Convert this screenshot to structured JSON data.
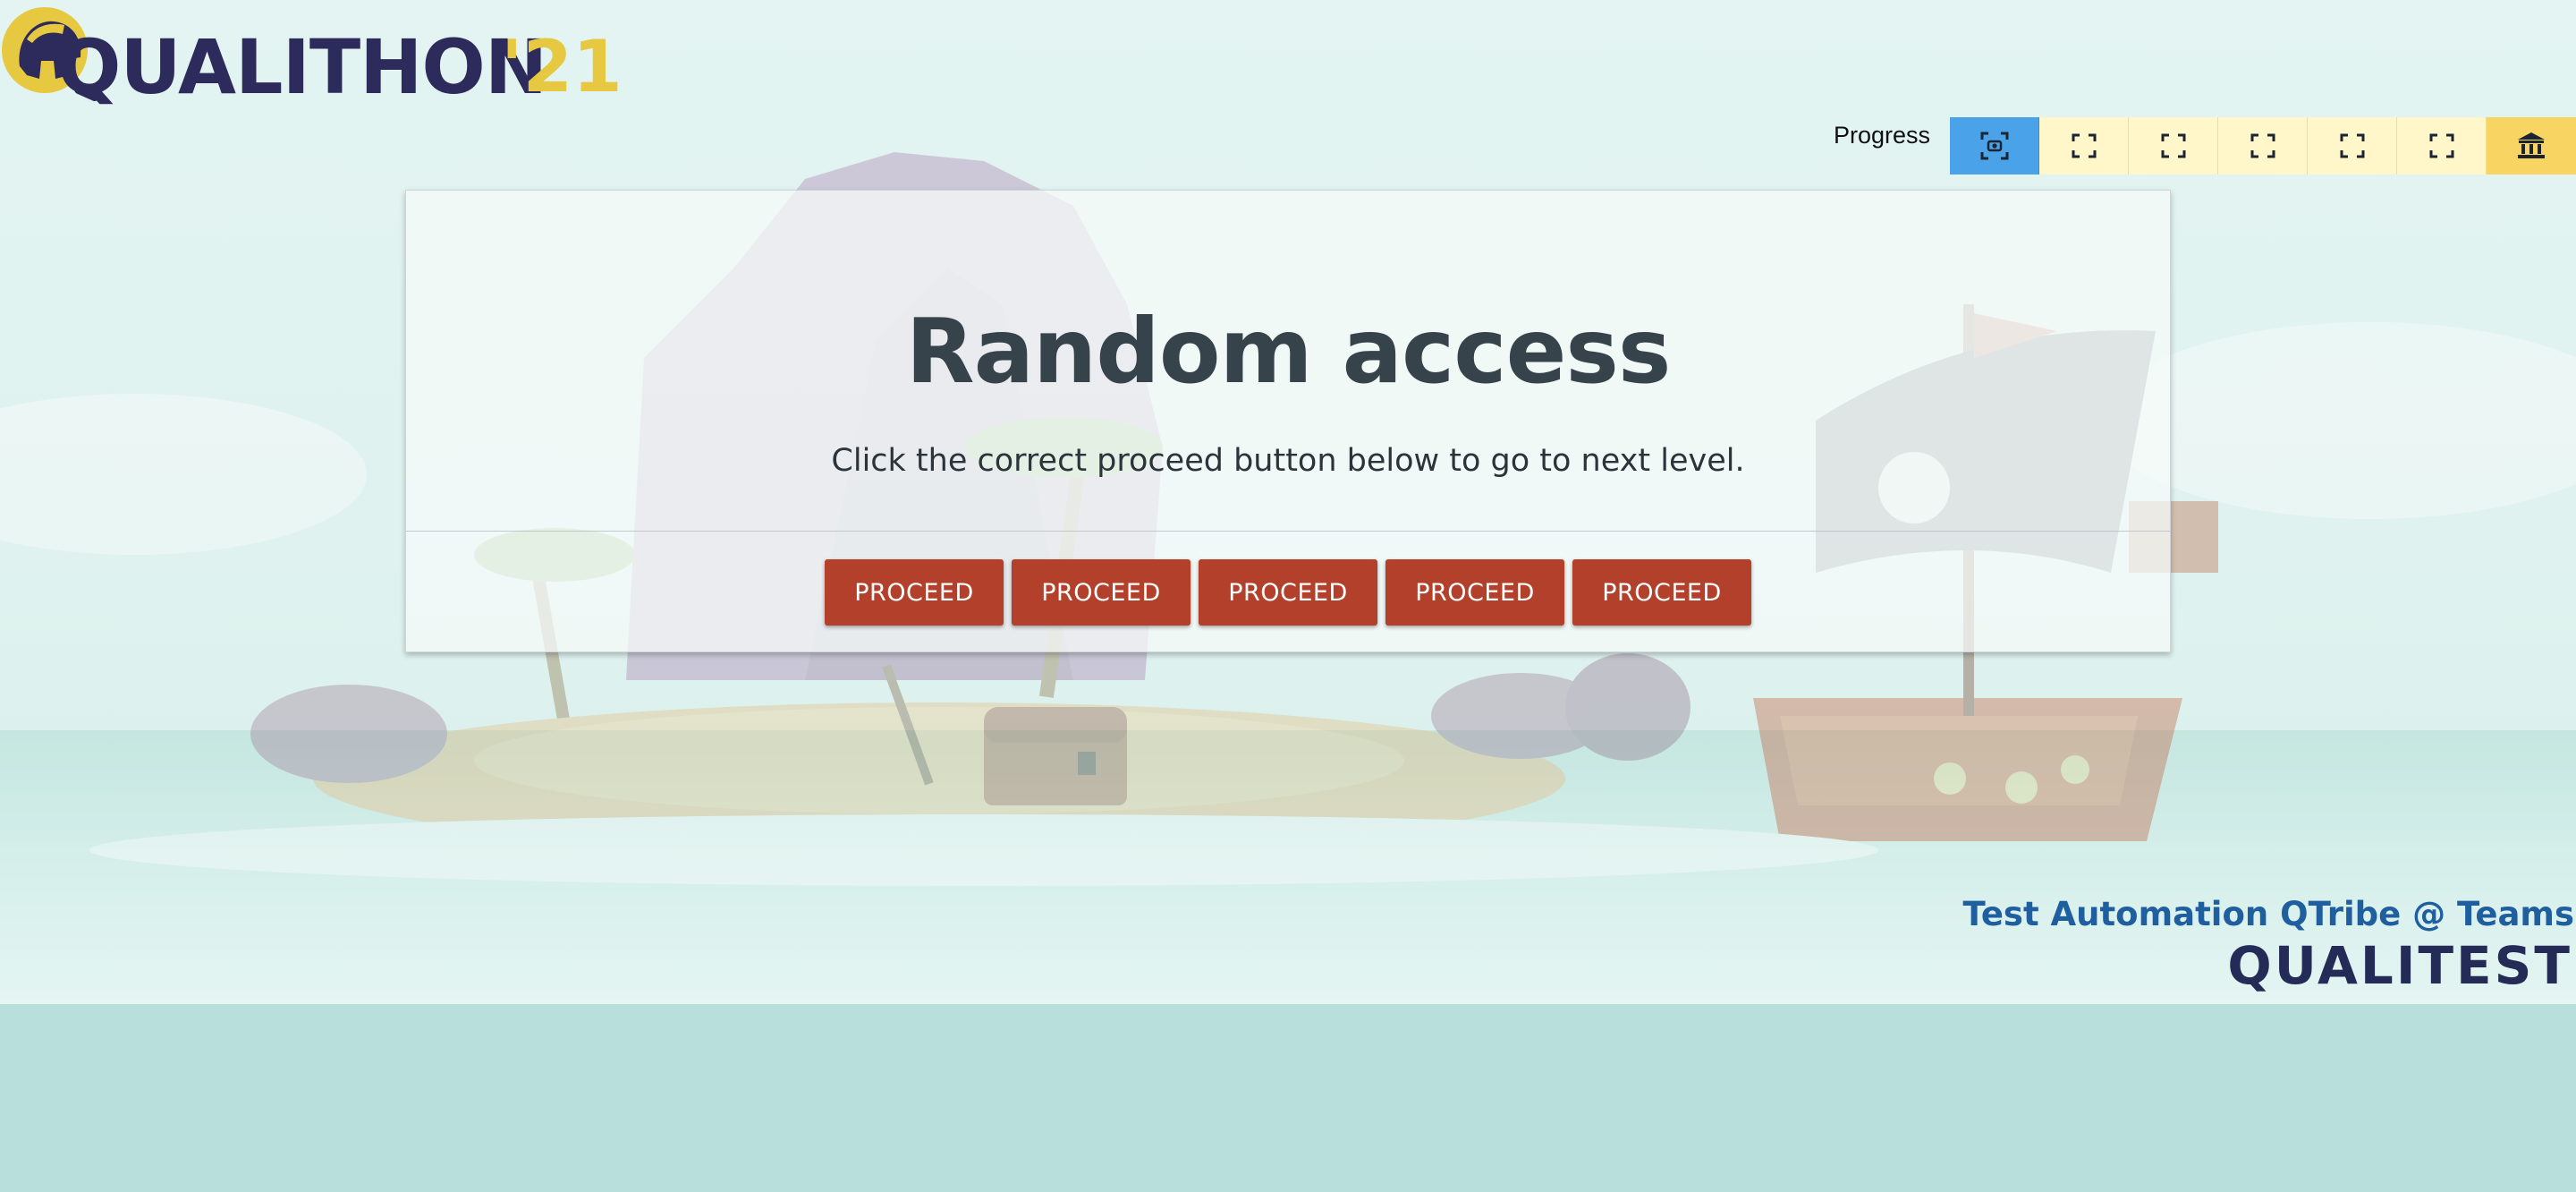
{
  "header": {
    "logo_text": "QUALITHON",
    "logo_year": "'21"
  },
  "progress": {
    "label": "Progress",
    "steps": [
      {
        "state": "current",
        "icon": "focus-camera-icon"
      },
      {
        "state": "pending",
        "icon": "fullscreen-corners-icon"
      },
      {
        "state": "pending",
        "icon": "fullscreen-corners-icon"
      },
      {
        "state": "pending",
        "icon": "fullscreen-corners-icon"
      },
      {
        "state": "pending",
        "icon": "fullscreen-corners-icon"
      },
      {
        "state": "pending",
        "icon": "fullscreen-corners-icon"
      },
      {
        "state": "goal",
        "icon": "bank-icon"
      }
    ]
  },
  "card": {
    "title": "Random access",
    "subtitle": "Click the correct proceed button below to go to next level.",
    "buttons": [
      "PROCEED",
      "PROCEED",
      "PROCEED",
      "PROCEED",
      "PROCEED"
    ]
  },
  "footer": {
    "team": "Test Automation QTribe @ Teams",
    "company": "QUALITEST"
  },
  "colors": {
    "proceed_button": "#b2402a",
    "progress_current": "#4aa3e8",
    "progress_pending": "#fff6c9",
    "progress_goal": "#f8d463",
    "title_text": "#37434b",
    "logo_navy": "#2d2a5c",
    "logo_gold": "#e6c841"
  }
}
